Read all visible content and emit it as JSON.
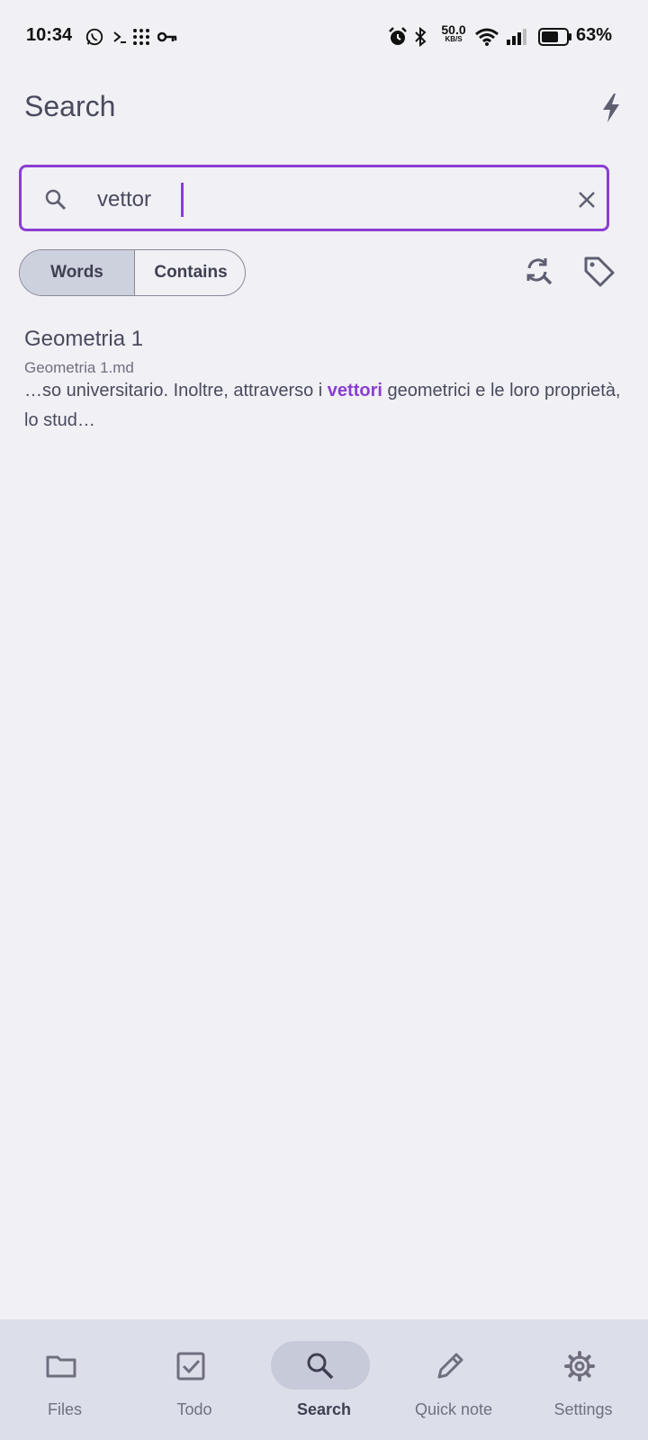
{
  "status_bar": {
    "time": "10:34",
    "net_speed_value": "50.0",
    "net_speed_unit": "KB/S",
    "battery_percent": "63%",
    "icons": [
      "whatsapp-icon",
      "terminal-icon",
      "app-grid-icon",
      "key-icon",
      "alarm-icon",
      "bluetooth-icon",
      "wifi-icon",
      "signal-icon",
      "battery-icon"
    ]
  },
  "header": {
    "title": "Search",
    "action_icon": "bolt-icon"
  },
  "search": {
    "value": "vettor",
    "accent_color": "#8b3ed2"
  },
  "filters": {
    "modes": [
      {
        "label": "Words",
        "selected": true
      },
      {
        "label": "Contains",
        "selected": false
      }
    ],
    "actions": [
      "refresh-search-icon",
      "tag-icon"
    ]
  },
  "results": [
    {
      "title": "Geometria 1",
      "file": "Geometria 1.md",
      "snippet_before": "…so universitario. Inoltre, attraverso i ",
      "snippet_match": "vettori",
      "snippet_after": " geometrici e le loro proprietà, lo stud…"
    }
  ],
  "bottom_nav": {
    "items": [
      {
        "label": "Files",
        "icon": "folder-icon",
        "active": false
      },
      {
        "label": "Todo",
        "icon": "checkbox-icon",
        "active": false
      },
      {
        "label": "Search",
        "icon": "search-icon",
        "active": true
      },
      {
        "label": "Quick note",
        "icon": "pencil-icon",
        "active": false
      },
      {
        "label": "Settings",
        "icon": "gear-icon",
        "active": false
      }
    ]
  }
}
